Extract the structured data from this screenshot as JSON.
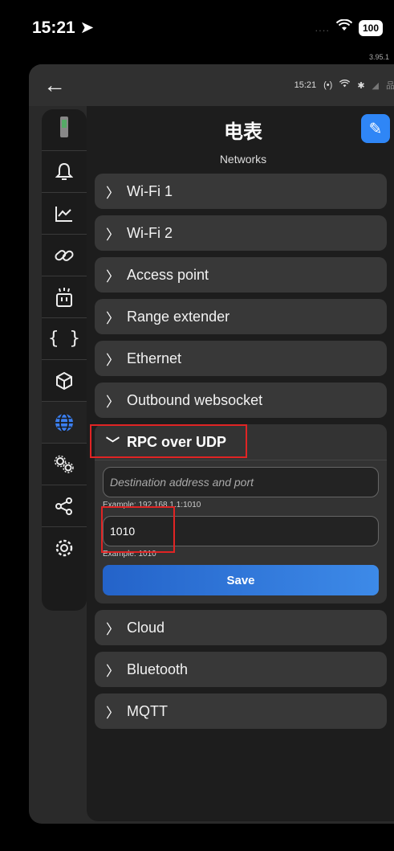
{
  "status_bar": {
    "time": "15:21",
    "dots": "....",
    "battery": "100",
    "version": "3.95.1"
  },
  "app_header": {
    "time": "15:21"
  },
  "device": {
    "title": "电表",
    "section": "Networks"
  },
  "sidebar": {
    "items": [
      {
        "icon": "device-thumbnail-icon"
      },
      {
        "icon": "bell-icon"
      },
      {
        "icon": "chart-icon"
      },
      {
        "icon": "link-icon"
      },
      {
        "icon": "script-icon"
      },
      {
        "icon": "code-braces-icon"
      },
      {
        "icon": "cube-icon"
      },
      {
        "icon": "globe-icon",
        "active": true
      },
      {
        "icon": "gears-icon"
      },
      {
        "icon": "share-icon"
      },
      {
        "icon": "settings-icon"
      }
    ]
  },
  "networks": {
    "items_before": [
      "Wi-Fi 1",
      "Wi-Fi 2",
      "Access point",
      "Range extender",
      "Ethernet",
      "Outbound websocket"
    ],
    "expanded": {
      "label": "RPC over UDP",
      "destination": {
        "placeholder": "Destination address and port",
        "value": "",
        "example": "Example: 192.168.1.1:1010"
      },
      "port": {
        "value": "1010",
        "example": "Example: 1010"
      },
      "save_label": "Save"
    },
    "items_after": [
      "Cloud",
      "Bluetooth",
      "MQTT"
    ]
  },
  "colors": {
    "accent": "#2f86f6",
    "highlight": "#e02424",
    "active_icon": "#7fb4ff"
  }
}
